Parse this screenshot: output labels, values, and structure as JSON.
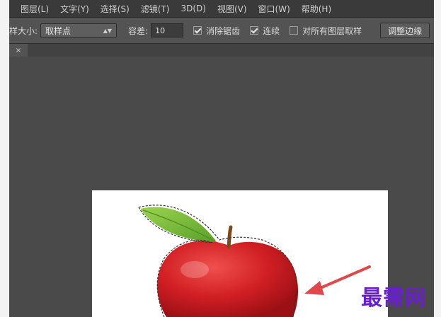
{
  "menu": [
    "图层(L)",
    "文字(Y)",
    "选择(S)",
    "滤镜(T)",
    "3D(D)",
    "视图(V)",
    "窗口(W)",
    "帮助(H)"
  ],
  "options": {
    "sample_size_label": "样大小:",
    "sample_size_value": "取样点",
    "tolerance_label": "容差:",
    "tolerance_value": "10",
    "antialias_label": "消除锯齿",
    "contiguous_label": "连续",
    "sample_all_layers_label": "对所有图层取样",
    "refine_edge_label": "调整边缘"
  },
  "tab": {
    "close_glyph": "×"
  },
  "watermark": "最需网",
  "colors": {
    "apple_red": "#d11f24",
    "leaf_green": "#7cc23c",
    "arrow": "#e0484b",
    "watermark": "#6a1fcf"
  }
}
